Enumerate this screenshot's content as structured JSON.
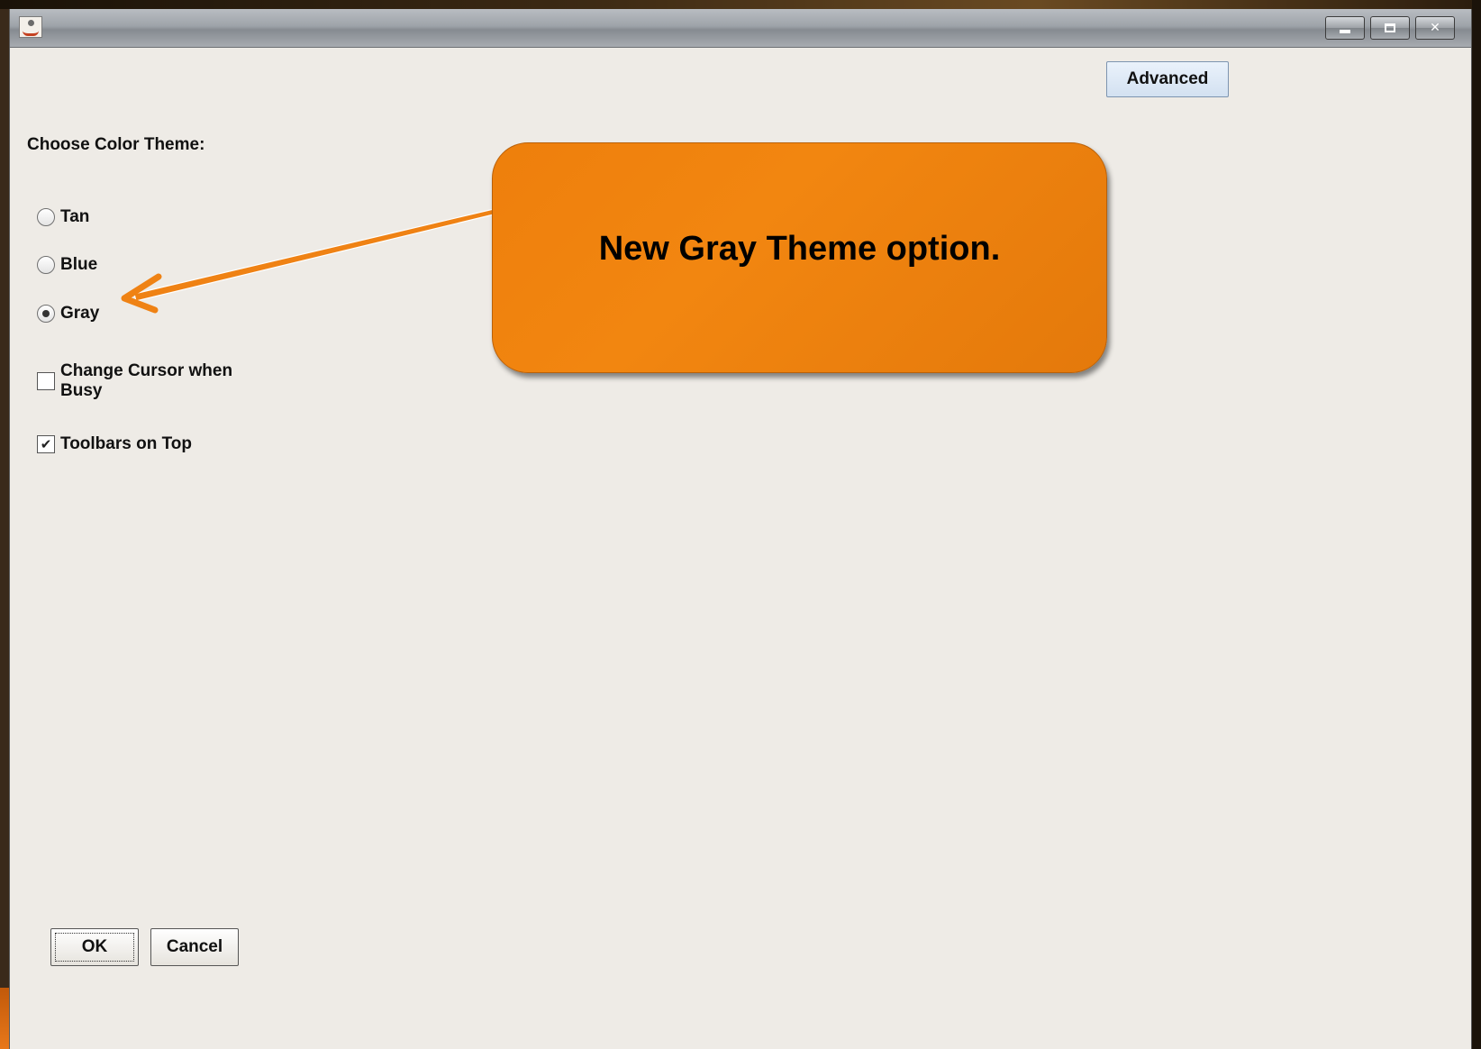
{
  "window": {
    "title": "",
    "controls": [
      "minimize",
      "maximize",
      "close"
    ],
    "close_glyph": "✕"
  },
  "advanced_button": {
    "label": "Advanced"
  },
  "theme": {
    "label": "Choose Color Theme:",
    "options": [
      {
        "label": "Tan",
        "selected": false
      },
      {
        "label": "Blue",
        "selected": false
      },
      {
        "label": "Gray",
        "selected": true
      }
    ]
  },
  "checkboxes": [
    {
      "label_line1": "Change Cursor when",
      "label_line2": "Busy",
      "checked": false
    },
    {
      "label": "Toolbars on Top",
      "checked": true,
      "check_glyph": "✔"
    }
  ],
  "buttons": {
    "ok": "OK",
    "cancel": "Cancel"
  },
  "callout": {
    "text": "New Gray Theme option.",
    "color": "#f08510"
  }
}
